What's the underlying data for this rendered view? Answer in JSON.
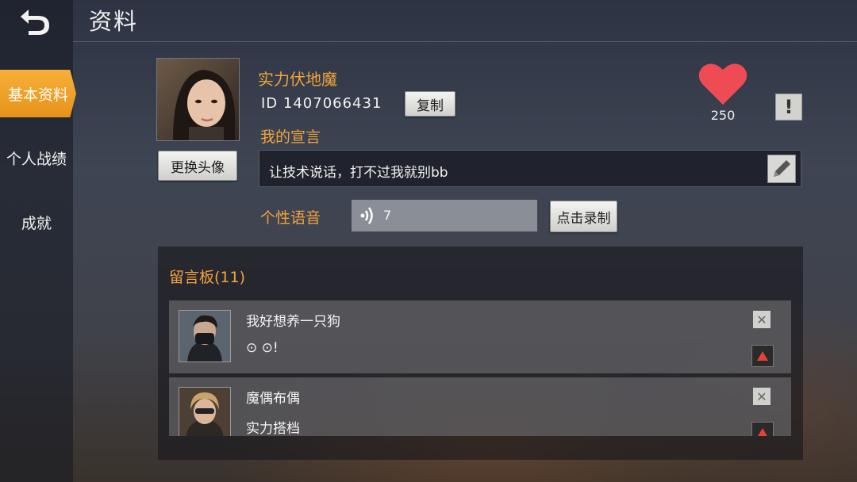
{
  "header": {
    "title": "资料"
  },
  "sidebar": {
    "items": [
      {
        "label": "基本资料"
      },
      {
        "label": "个人战绩"
      },
      {
        "label": "成就"
      }
    ]
  },
  "profile": {
    "change_avatar_label": "更换头像",
    "nickname": "实力伏地魔",
    "id_text": "ID 1407066431",
    "copy_label": "复制",
    "declaration_label": "我的宣言",
    "declaration_text": "让技术说话，打不过我就别bb",
    "voice_label": "个性语音",
    "voice_value": "7",
    "record_label": "点击录制",
    "likes": "250",
    "report_label": "!"
  },
  "board": {
    "title": "留言板(11)",
    "messages": [
      {
        "name": "我好想养一只狗",
        "body": "⊙  ⊙!"
      },
      {
        "name": "魔偶布偶",
        "body": "实力搭档"
      }
    ]
  },
  "colors": {
    "accent": "#f2a33c",
    "active_tab": "#f0a02c",
    "heart": "#ef4b55"
  }
}
